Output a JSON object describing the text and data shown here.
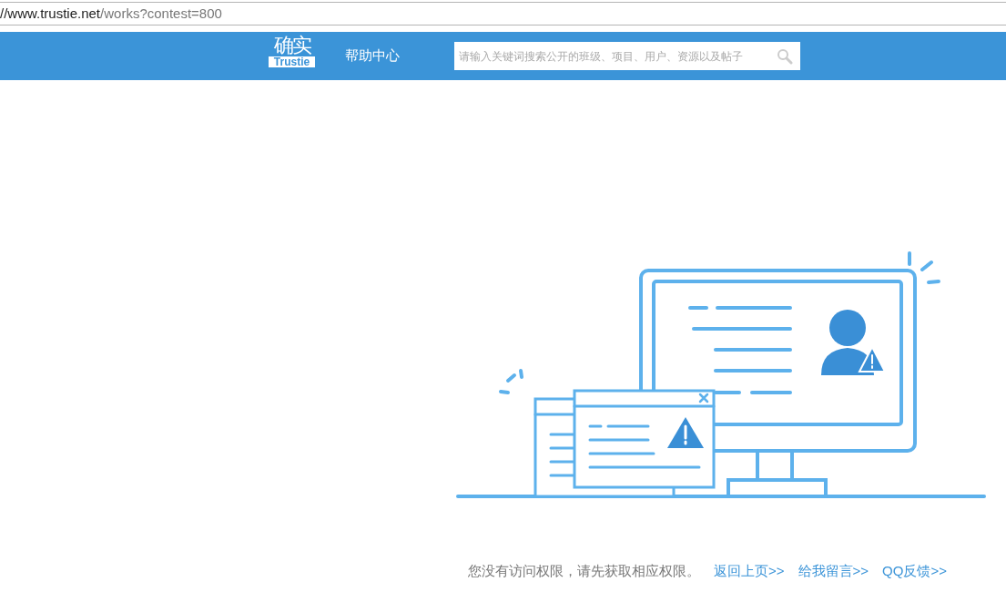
{
  "address_bar": {
    "host": "//www.trustie.net",
    "path": "/works?contest=800"
  },
  "header": {
    "logo": {
      "glyphs": "确实",
      "word": "Trustie"
    },
    "help_link": "帮助中心",
    "search": {
      "placeholder": "请输入关键词搜索公开的班级、项目、用户、资源以及帖子"
    }
  },
  "message": "您没有访问权限，请先获取相应权限。",
  "links": [
    "返回上页>>",
    "给我留言>>",
    "QQ反馈>>"
  ]
}
